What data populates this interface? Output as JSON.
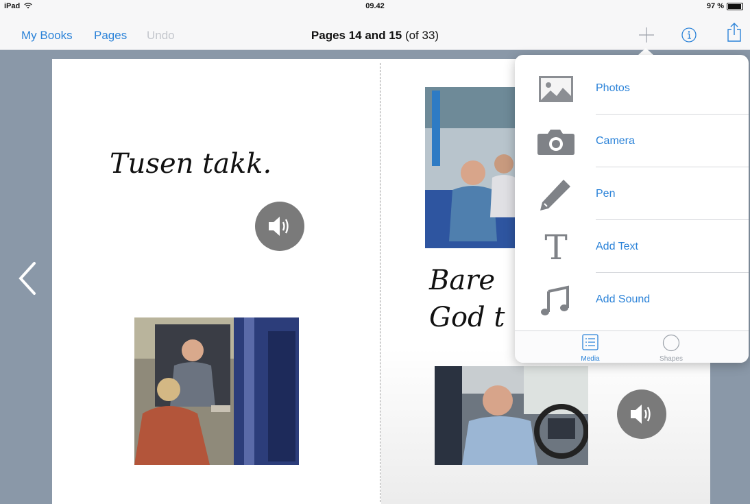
{
  "status_bar": {
    "device": "iPad",
    "time": "09.42",
    "battery": "97 %"
  },
  "nav": {
    "my_books": "My Books",
    "pages": "Pages",
    "undo": "Undo",
    "title_bold": "Pages 14 and 15",
    "title_rest": " (of 33)",
    "accent": "#2a82d8"
  },
  "left_page": {
    "text": "Tusen takk."
  },
  "right_page": {
    "text_line1": "Bare",
    "text_line2": "God t"
  },
  "menu": {
    "items": [
      {
        "label": "Photos",
        "icon": "photos-icon"
      },
      {
        "label": "Camera",
        "icon": "camera-icon"
      },
      {
        "label": "Pen",
        "icon": "pen-icon"
      },
      {
        "label": "Add Text",
        "icon": "text-icon"
      },
      {
        "label": "Add Sound",
        "icon": "music-note-icon"
      }
    ],
    "tabs": [
      {
        "label": "Media",
        "icon": "list-icon",
        "selected": true
      },
      {
        "label": "Shapes",
        "icon": "circle-icon",
        "selected": false
      }
    ]
  }
}
